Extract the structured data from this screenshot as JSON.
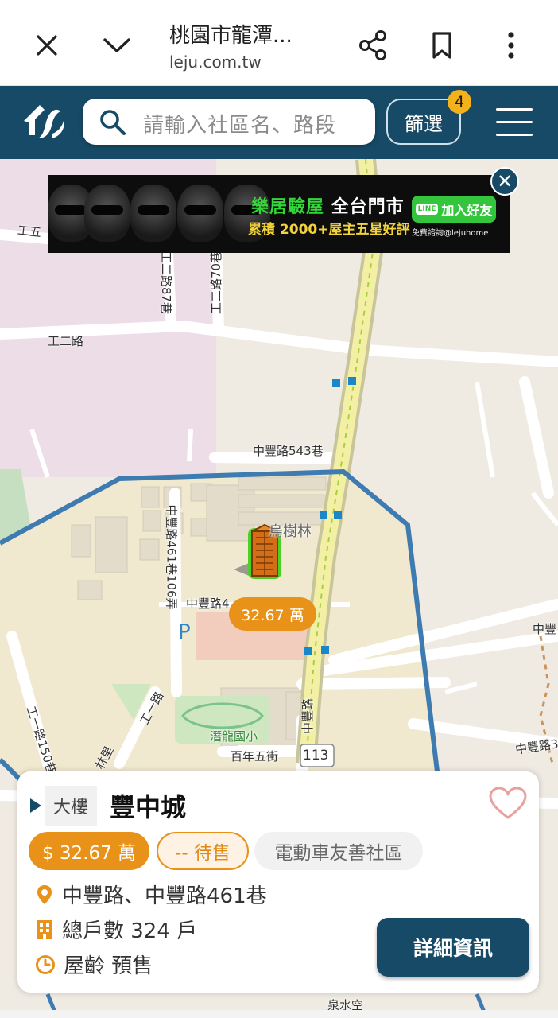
{
  "browser": {
    "title": "桃園市龍潭...",
    "url": "leju.com.tw"
  },
  "header": {
    "search_placeholder": "請輸入社區名、路段",
    "filter_label": "篩選",
    "filter_count": "4"
  },
  "ad": {
    "title_green": "樂居驗屋",
    "title_white": " 全台門市",
    "subtitle": "累積 2000+屋主五星好評",
    "line_badge": "LINE",
    "line_label": "加入好友",
    "note": "免費諮詢@lejuhome",
    "close_label": "✕"
  },
  "map": {
    "labels": {
      "road_gongwu": "工五",
      "road_gonger": "工二路",
      "road_gonger87": "工二路87巷",
      "road_gonger70": "工二路70巷",
      "road_zhongfeng543": "中豐路543巷",
      "road_zhongfeng461_106": "中豐路461巷106弄",
      "place_wanshulin": "烏樹林",
      "road_zhongfeng4": "中豐路4",
      "parking": "P",
      "road_zhongfeng_right": "中豐",
      "road_gongyi150": "工一路150巷",
      "road_gongyi": "工一路",
      "school": "潛龍國小",
      "road_bainian5": "百年五街",
      "road_zhongfeng_vertical": "中豐路",
      "route_113": "113",
      "road_zhongfeng3": "中豐路3",
      "road_li": "林里",
      "road_quanshui": "泉水空"
    },
    "marker_price": "32.67 萬"
  },
  "card": {
    "type": "大樓",
    "name": "豐中城",
    "price_chip": "$ 32.67 萬",
    "status_chip": "-- 待售",
    "feature_chip": "電動車友善社區",
    "address": "中豐路、中豐路461巷",
    "households": "總戶數 324 戶",
    "age": "屋齡 預售",
    "detail_button": "詳細資訊"
  },
  "colors": {
    "brand": "#174a66",
    "accent": "#e8921a",
    "badge": "#f3b21b"
  }
}
